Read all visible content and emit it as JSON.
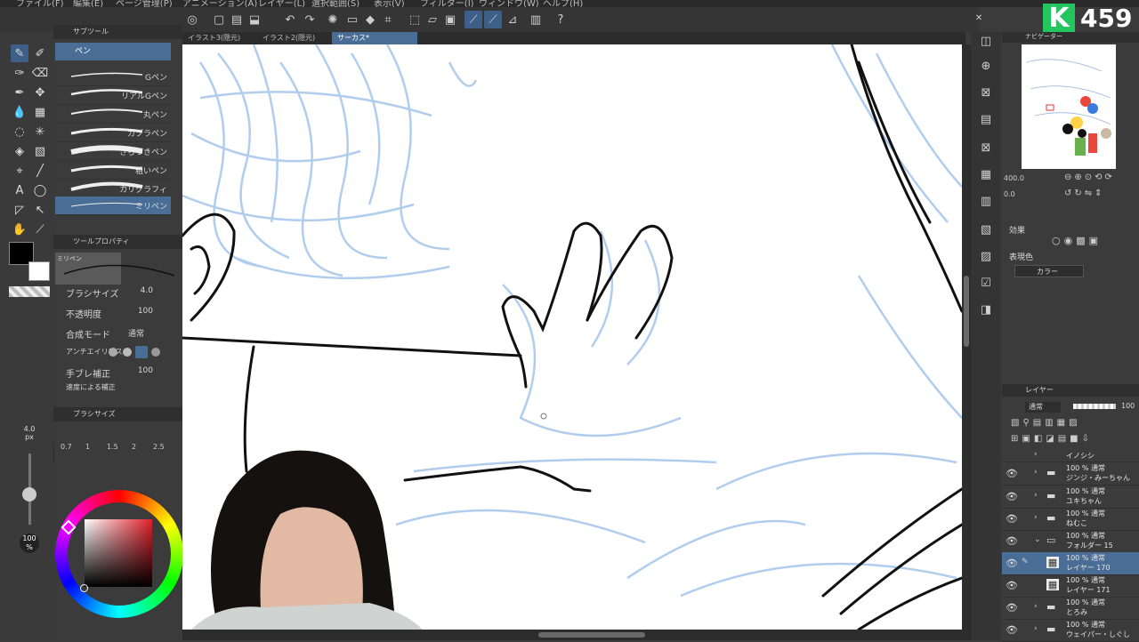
{
  "menu": [
    "ファイル(F)",
    "編集(E)",
    "ページ管理(P)",
    "アニメーション(A)",
    "レイヤー(L)",
    "選択範囲(S)",
    "表示(V)",
    "フィルター(I)",
    "ウィンドウ(W)",
    "ヘルプ(H)"
  ],
  "badge": {
    "letter": "K",
    "count": "459",
    "color": "#22c55e"
  },
  "tabs": [
    {
      "label": "イラスト3(隠元)",
      "active": false
    },
    {
      "label": "イラスト2(隠元)",
      "active": false
    },
    {
      "label": "サーカス*",
      "active": true
    }
  ],
  "subtool": {
    "tab1": "ツール",
    "tab2": "サブツール",
    "group": "ペン",
    "brushes": [
      "Gペン",
      "リアルGペン",
      "丸ペン",
      "カブラペン",
      "さらつきペン",
      "粗いペン",
      "カリグラフィ",
      "ミリペン"
    ],
    "selected": "ミリペン"
  },
  "toolprop": {
    "title": "ツールプロパティ",
    "preview_label": "ミリペン",
    "brush_size_label": "ブラシサイズ",
    "brush_size": "4.0",
    "opacity_label": "不透明度",
    "opacity": "100",
    "blend_label": "合成モード",
    "blend": "通常",
    "antialias_label": "アンチエイリアス",
    "stabilize_label": "手ブレ補正",
    "stabilize": "100",
    "extra_label": "速度による補正"
  },
  "brushsize_panel": {
    "title": "ブラシサイズ",
    "current": "4.0",
    "unit": "px",
    "presets": [
      "0.7",
      "1",
      "1.5",
      "2",
      "2.5"
    ]
  },
  "color": {
    "main": "#000000",
    "sub": "#ffffff",
    "opacity": "100",
    "opacity_unit": "%",
    "hue_color": "#e0202a"
  },
  "navigator": {
    "title": "ナビゲーター",
    "zoom": "400.0",
    "angle": "0.0"
  },
  "effects": {
    "title": "効果",
    "expression_title": "表現色",
    "expression_value": "カラー"
  },
  "layers": {
    "title": "レイヤー",
    "blend": "通常",
    "opacity": "100",
    "items": [
      {
        "line1": "イノシシ",
        "line2": "",
        "type": "folder",
        "expanded": false
      },
      {
        "line1": "100 % 通常",
        "line2": "ジンジ・みーちゃん",
        "type": "folder",
        "expanded": false
      },
      {
        "line1": "100 % 通常",
        "line2": "ユキちゃん",
        "type": "folder",
        "expanded": false
      },
      {
        "line1": "100 % 通常",
        "line2": "ねむこ",
        "type": "folder",
        "expanded": false
      },
      {
        "line1": "100 % 通常",
        "line2": "フォルダー 15",
        "type": "folder",
        "expanded": true
      },
      {
        "line1": "100 % 通常",
        "line2": "レイヤー 170",
        "type": "raster",
        "selected": true
      },
      {
        "line1": "100 % 通常",
        "line2": "レイヤー 171",
        "type": "raster"
      },
      {
        "line1": "100 % 通常",
        "line2": "とろみ",
        "type": "folder",
        "expanded": false
      },
      {
        "line1": "100 % 通常",
        "line2": "ウェイパー・しぐし",
        "type": "folder",
        "expanded": false
      }
    ]
  }
}
